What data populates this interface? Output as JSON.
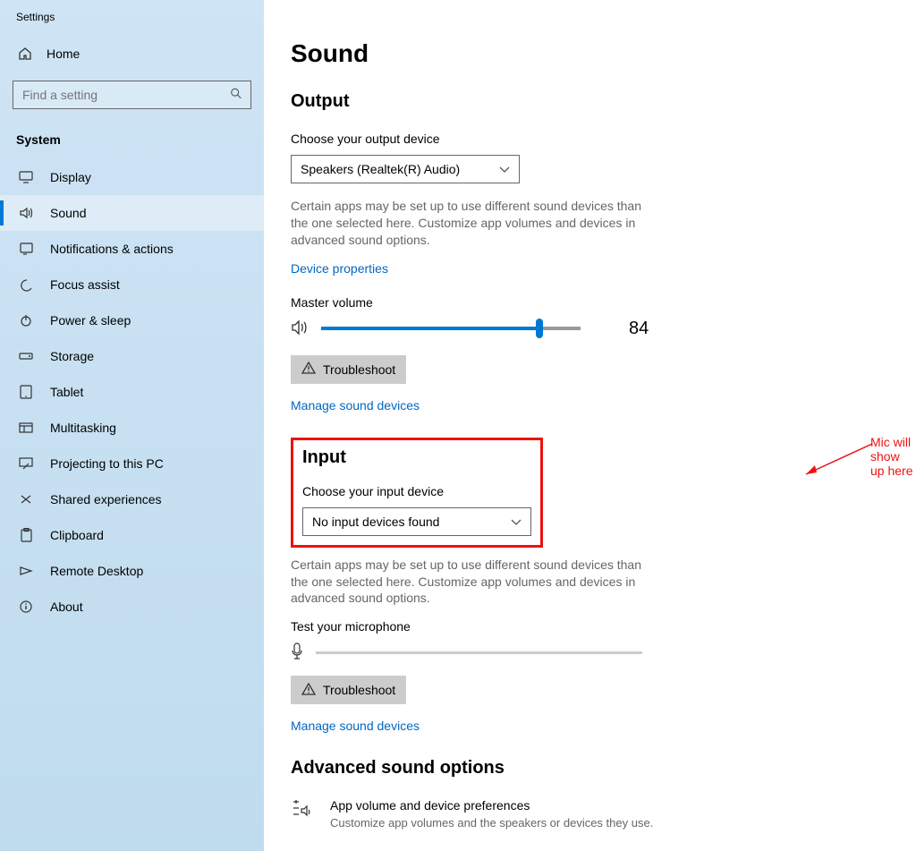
{
  "window_title": "Settings",
  "home_label": "Home",
  "search_placeholder": "Find a setting",
  "group_label": "System",
  "nav": [
    {
      "label": "Display"
    },
    {
      "label": "Sound"
    },
    {
      "label": "Notifications & actions"
    },
    {
      "label": "Focus assist"
    },
    {
      "label": "Power & sleep"
    },
    {
      "label": "Storage"
    },
    {
      "label": "Tablet"
    },
    {
      "label": "Multitasking"
    },
    {
      "label": "Projecting to this PC"
    },
    {
      "label": "Shared experiences"
    },
    {
      "label": "Clipboard"
    },
    {
      "label": "Remote Desktop"
    },
    {
      "label": "About"
    }
  ],
  "page_title": "Sound",
  "output": {
    "title": "Output",
    "choose_label": "Choose your output device",
    "device": "Speakers (Realtek(R) Audio)",
    "helper": "Certain apps may be set up to use different sound devices than the one selected here. Customize app volumes and devices in advanced sound options.",
    "device_properties": "Device properties",
    "master_volume_label": "Master volume",
    "master_volume": "84",
    "troubleshoot": "Troubleshoot",
    "manage": "Manage sound devices"
  },
  "input": {
    "title": "Input",
    "choose_label": "Choose your input device",
    "device": "No input devices found",
    "helper": "Certain apps may be set up to use different sound devices than the one selected here. Customize app volumes and devices in advanced sound options.",
    "test_label": "Test your microphone",
    "troubleshoot": "Troubleshoot",
    "manage": "Manage sound devices"
  },
  "advanced": {
    "title": "Advanced sound options",
    "row_title": "App volume and device preferences",
    "row_sub": "Customize app volumes and the speakers or devices they use."
  },
  "annotation": "Mic will show up here"
}
